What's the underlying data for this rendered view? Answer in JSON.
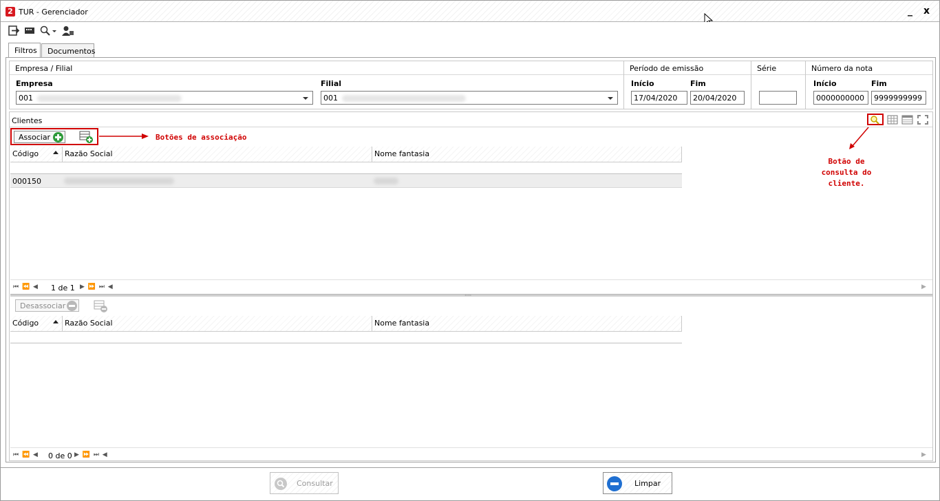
{
  "window": {
    "title": "TUR - Gerenciador",
    "logo_text": "2",
    "minimize": "_",
    "close": "x"
  },
  "toolbar": {
    "icons": [
      "exit-icon",
      "card-icon",
      "search-dropdown-icon",
      "user-icon"
    ]
  },
  "tabs": [
    {
      "label": "Filtros",
      "active": true
    },
    {
      "label": "Documentos",
      "active": false
    }
  ],
  "empresa_filial": {
    "group_title": "Empresa / Filial",
    "empresa_label": "Empresa",
    "empresa_value": "001",
    "filial_label": "Filial",
    "filial_value": "001"
  },
  "periodo": {
    "group_title": "Período de emissão",
    "inicio_label": "Início",
    "inicio_value": "17/04/2020",
    "fim_label": "Fim",
    "fim_value": "20/04/2020"
  },
  "serie": {
    "group_title": "Série",
    "value": ""
  },
  "numero_nota": {
    "group_title": "Número da nota",
    "inicio_label": "Início",
    "inicio_value": "0000000000",
    "fim_label": "Fim",
    "fim_value": "9999999999"
  },
  "clientes": {
    "title": "Clientes",
    "associar_label": "Associar",
    "annotation_assoc": "Botões de associação",
    "annotation_consulta": [
      "Botão de",
      "consulta do",
      "cliente."
    ],
    "columns": [
      "Código",
      "Razão Social",
      "Nome fantasia"
    ],
    "rows": [
      {
        "codigo": "000150"
      }
    ],
    "pager": "1 de 1",
    "desassociar_label": "Desassociar",
    "lower_pager": "0 de 0"
  },
  "footer": {
    "consultar_label": "Consultar",
    "limpar_label": "Limpar"
  },
  "colors": {
    "annotation_red": "#d00000",
    "green": "#2e9a3a",
    "blue": "#1f6fd1"
  }
}
